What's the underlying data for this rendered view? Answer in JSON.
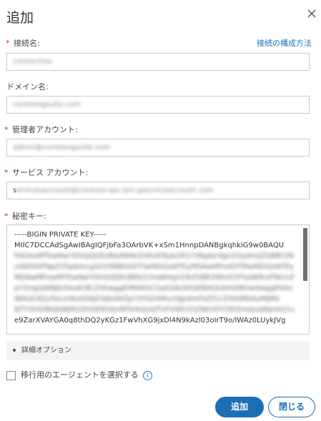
{
  "dialog": {
    "title": "追加",
    "close_icon": "close-icon"
  },
  "form": {
    "connection_name": {
      "label": "接続名:",
      "required": "*",
      "value": "connection"
    },
    "config_link": "接続の構成方法",
    "domain_name": {
      "label": "ドメイン名:",
      "value": "contosogsuite.com"
    },
    "admin_account": {
      "label": "管理者アカウント:",
      "required": "*",
      "value": "admin@contosogsuite.com"
    },
    "service_account": {
      "label": "サービス アカウント:",
      "required": "*",
      "value_prefix": "s",
      "value_rest": "ervicesaccount@contoso-api.iam.gserviceaccount.com"
    },
    "private_key": {
      "label": "秘密キー:",
      "required": "*",
      "lines": [
        "-----BIGIN PRIVATE KEY-----",
        "MIIC7DCCAdSgAwIBAgIQFjbFa3OArbVK+xSm1HnnpDANBgkqhkiG9w0BAQU",
        "FADAxMTkwNwYDVQQDEzBSdWNrZXRzIFByb2R1Y3Rpb24gU2VydmljZSBBY2N",
        "vdW50IFNpZ25pbmcgS2V5MB4XDTIwMDQxNTEyMDAwMFoXDTMwMDQxNTEy",
        "MDAwMFowMTEwNwYDVQQDEzBEb21haW4gV2lkZSBEZWxlZ2F0aW9uIFNlcnZ",
        "pY2UgQWNjb3VudCBLZXkwggEiMA0GCSqGSIb3DQEBAQUAA4IBDwAwggEKAo",
        "IBAQC8Zy5kLmNvbS9jZXJ0aWZpY2F0ZXMvcHJpdmF0ZS1rZXktMDAxMjM0",
        "NTY3ODlBQkNERUZHSElKS0xNTk9QUVJTVFVWV1hZWmFiY2RlZmdoaWprbG1u",
        "e9ZarXVAYGA0q8thDQ2yKGz1FwVhXG9jxDl4N9kAzl03oIrT9o/lWAz0LUykJVg"
      ],
      "blurred": [
        false,
        false,
        true,
        true,
        true,
        true,
        true,
        true,
        false
      ]
    }
  },
  "advanced_options": "詳細オプション",
  "migration_agent_checkbox": "移行用のエージェントを選択する",
  "buttons": {
    "add": "追加",
    "close": "閉じる"
  },
  "colors": {
    "accent": "#1b6fb5",
    "required": "#d9262d",
    "link": "#1e73be"
  }
}
